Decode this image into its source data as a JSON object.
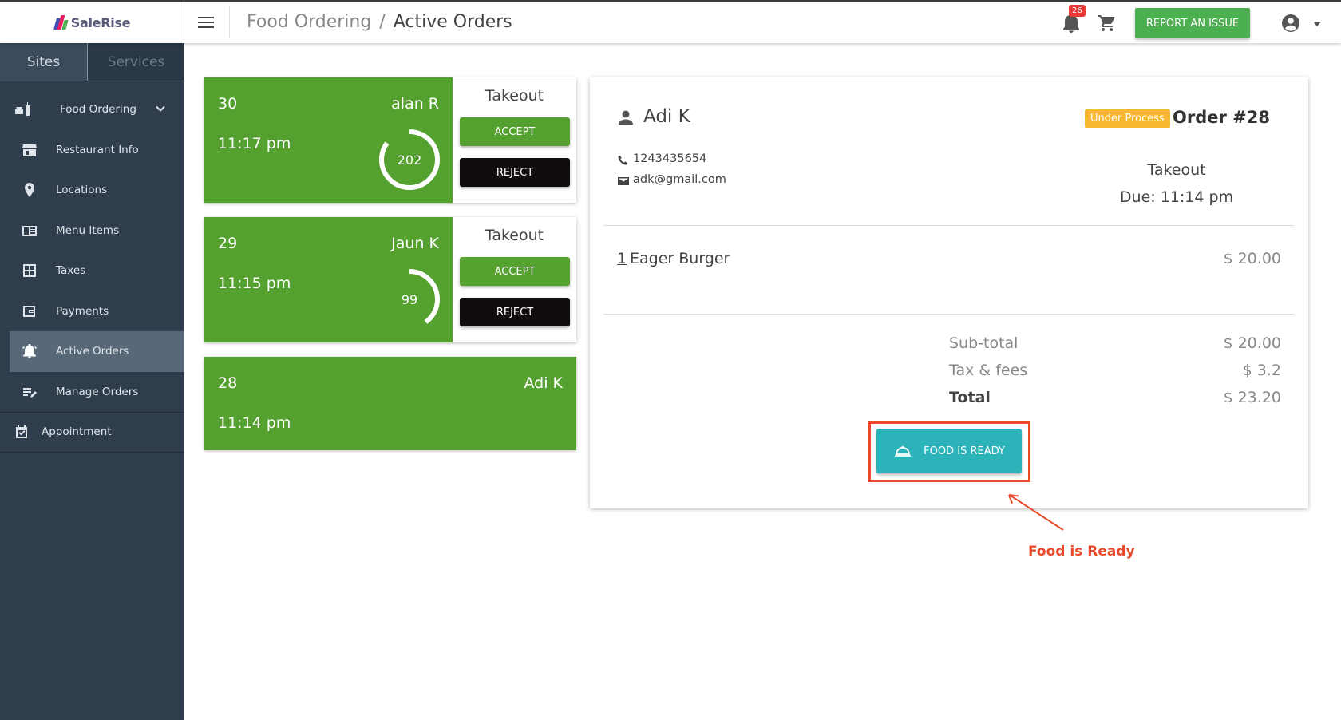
{
  "app": {
    "logo_text": "SaleRise",
    "breadcrumb": [
      "Food Ordering",
      "Active Orders"
    ],
    "breadcrumb_sep": "/",
    "notifications_count": "26",
    "report_button": "REPORT AN ISSUE"
  },
  "sidebar": {
    "tabs": [
      "Sites",
      "Services"
    ],
    "parent_item": "Food Ordering",
    "items": [
      {
        "label": "Restaurant Info",
        "icon": "storefront-icon"
      },
      {
        "label": "Locations",
        "icon": "location-pin-icon"
      },
      {
        "label": "Menu Items",
        "icon": "menu-book-icon"
      },
      {
        "label": "Taxes",
        "icon": "calculator-icon"
      },
      {
        "label": "Payments",
        "icon": "wallet-icon"
      },
      {
        "label": "Active Orders",
        "icon": "bell-icon"
      },
      {
        "label": "Manage Orders",
        "icon": "edit-list-icon"
      }
    ],
    "bottom_item": "Appointment"
  },
  "orders": [
    {
      "number": "30",
      "customer": "alan R",
      "time": "11:17 pm",
      "type": "Takeout",
      "timer": "202",
      "timer_fraction": 0.85,
      "accept": "ACCEPT",
      "reject": "REJECT"
    },
    {
      "number": "29",
      "customer": "Jaun K",
      "time": "11:15 pm",
      "type": "Takeout",
      "timer": "99",
      "timer_fraction": 0.4,
      "accept": "ACCEPT",
      "reject": "REJECT"
    },
    {
      "number": "28",
      "customer": "Adi K",
      "time": "11:14 pm"
    }
  ],
  "detail": {
    "customer": "Adi K",
    "status": "Under Process",
    "order_title": "Order #28",
    "phone": "1243435654",
    "email": "adk@gmail.com",
    "type": "Takeout",
    "due": "Due: 11:14 pm",
    "item": {
      "qty": "1",
      "name": "Eager Burger",
      "price": "$ 20.00"
    },
    "subtotal_label": "Sub-total",
    "subtotal": "$ 20.00",
    "tax_label": "Tax & fees",
    "tax": "$ 3.2",
    "total_label": "Total",
    "total": "$ 23.20",
    "ready_button": "FOOD IS READY"
  },
  "annotation": {
    "text": "Food is Ready"
  },
  "colors": {
    "green": "#55a130",
    "teal": "#2bb3b9",
    "sidebar": "#2f3d4d",
    "annotation": "#ea4a2a",
    "badge": "#f7b731"
  }
}
